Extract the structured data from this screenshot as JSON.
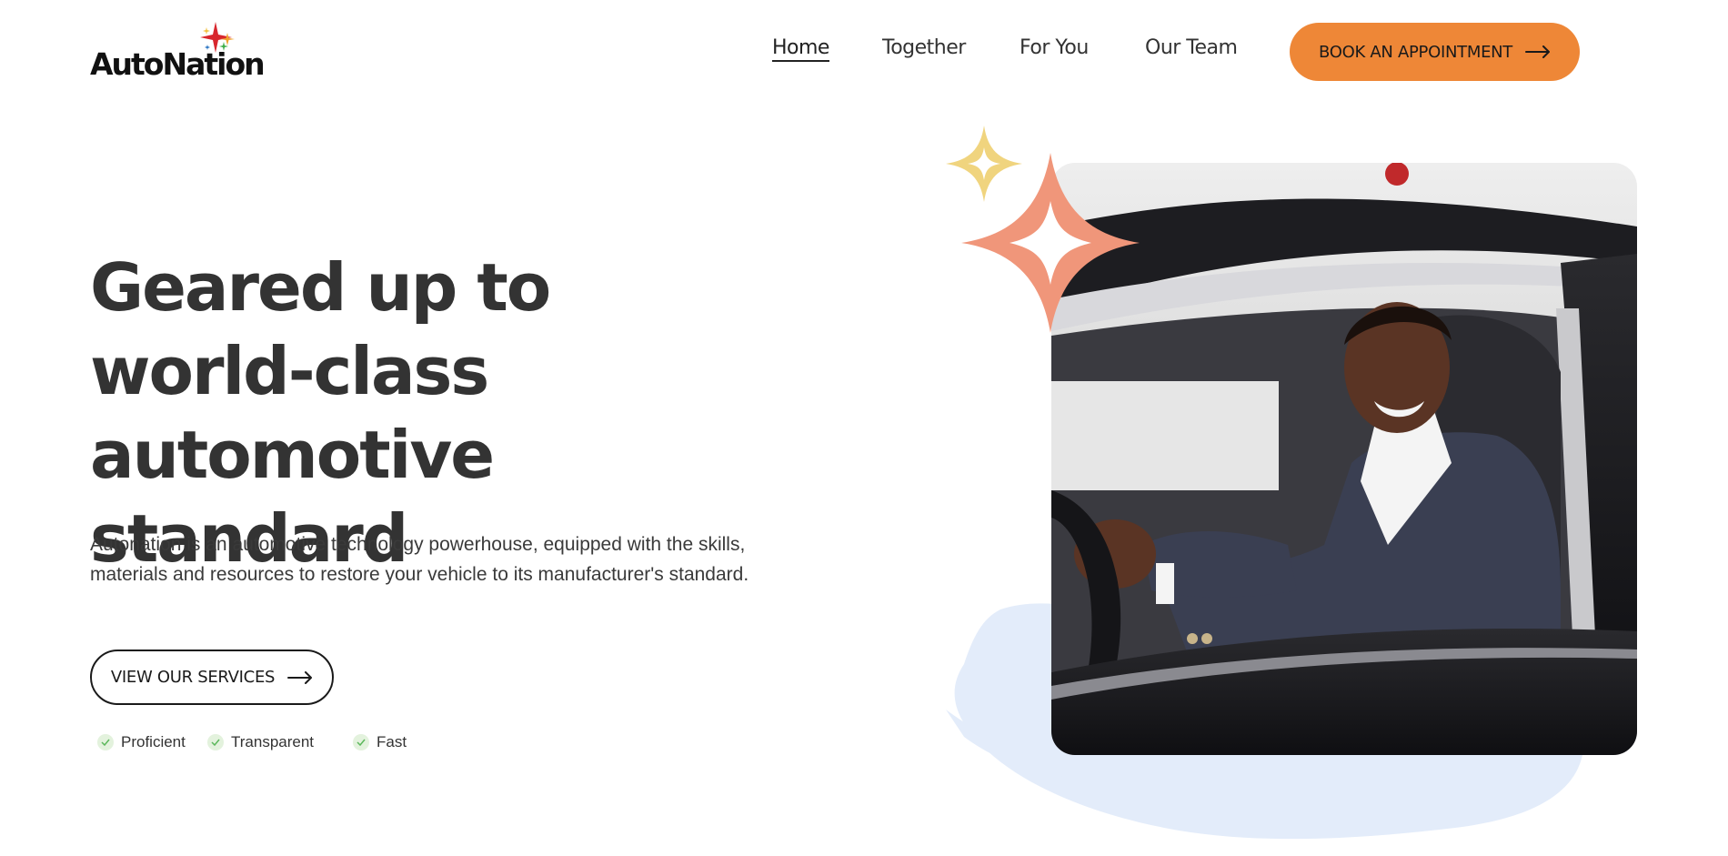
{
  "brand": {
    "name": "AutoNation"
  },
  "nav": {
    "items": [
      {
        "label": "Home",
        "active": true
      },
      {
        "label": "Together",
        "active": false
      },
      {
        "label": "For You",
        "active": false
      },
      {
        "label": "Our Team",
        "active": false
      }
    ],
    "cta_label": "BOOK AN APPOINTMENT"
  },
  "hero": {
    "title": "Geared up to world-class automotive standard",
    "description": "Autonation is an automotive technology powerhouse, equipped with the skills, materials and resources to restore your vehicle to its manufacturer's standard.",
    "button_label": "VIEW OUR SERVICES",
    "features": [
      "Proficient",
      "Transparent",
      "Fast"
    ]
  },
  "colors": {
    "accent_orange": "#ee8737",
    "spark_orange": "#f0967a",
    "spark_yellow": "#f0d47e",
    "blob_blue": "#e3ecfa",
    "check_green": "#5cb85c"
  },
  "icons": [
    "arrow-right-icon",
    "check-icon",
    "sparkle-icon"
  ]
}
